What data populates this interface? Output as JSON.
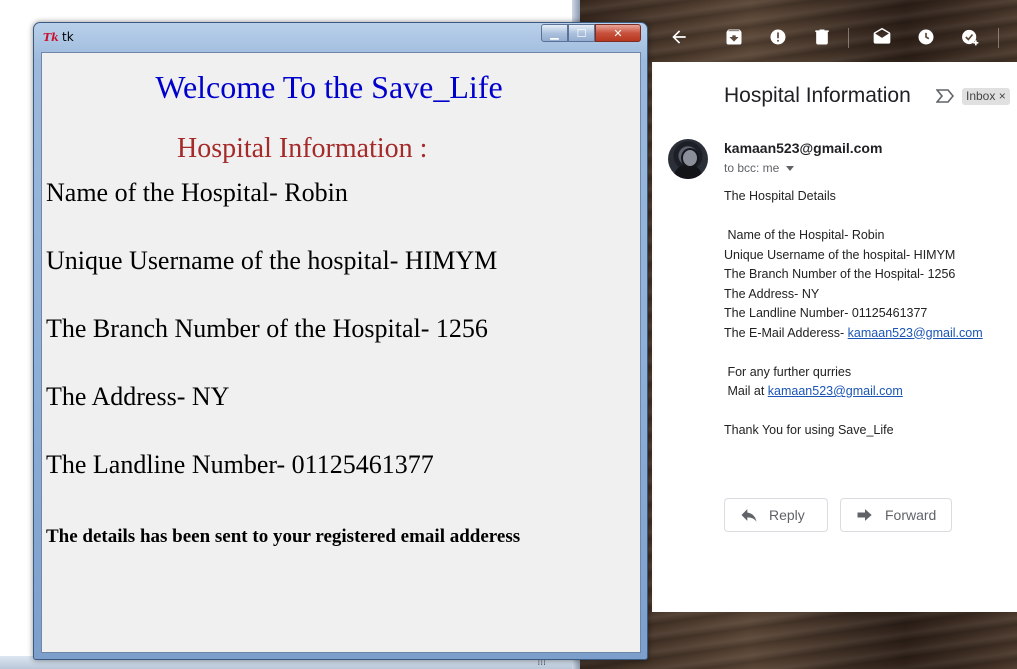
{
  "tk_window": {
    "logo": "Tk",
    "title": "tk",
    "controls": {
      "minimize": "▁",
      "maximize": "☐",
      "close": "✕"
    },
    "welcome": "Welcome To the Save_Life",
    "heading": "Hospital Information :",
    "lines": [
      "Name of the Hospital- Robin",
      "Unique Username of the hospital- HIMYM",
      "The Branch Number of the Hospital- 1256",
      "The Address- NY",
      "The Landline Number- 01125461377"
    ],
    "note": "The details has been sent to your registered email adderess",
    "colors": {
      "welcome": "#0000cc",
      "heading": "#a52a2a"
    }
  },
  "gmail": {
    "toolbar_icons": [
      "back-arrow-icon",
      "archive-icon",
      "report-spam-icon",
      "delete-icon",
      "mark-unread-icon",
      "snooze-icon",
      "add-to-tasks-icon"
    ],
    "subject": "Hospital Information",
    "label_chip": "Inbox ×",
    "sender": "kamaan523@gmail.com",
    "recipient": "to bcc: me",
    "body": {
      "intro": "The Hospital Details",
      "details": [
        " Name of the Hospital- Robin",
        "Unique Username of the hospital- HIMYM",
        "The Branch Number of the Hospital- 1256",
        "The Address- NY",
        "The Landline Number- 01125461377"
      ],
      "email_label": "The E-Mail Adderess- ",
      "email_link": "kamaan523@gmail.com",
      "further_queries": " For any further qurries",
      "mail_at_label": " Mail at ",
      "mail_at_link": "kamaan523@gmail.com",
      "thanks": "Thank You for using Save_Life"
    },
    "reply_label": "Reply",
    "forward_label": "Forward",
    "link_color": "#1a55b5"
  },
  "taskbar": {
    "grip": "⁞⁞⁞"
  }
}
